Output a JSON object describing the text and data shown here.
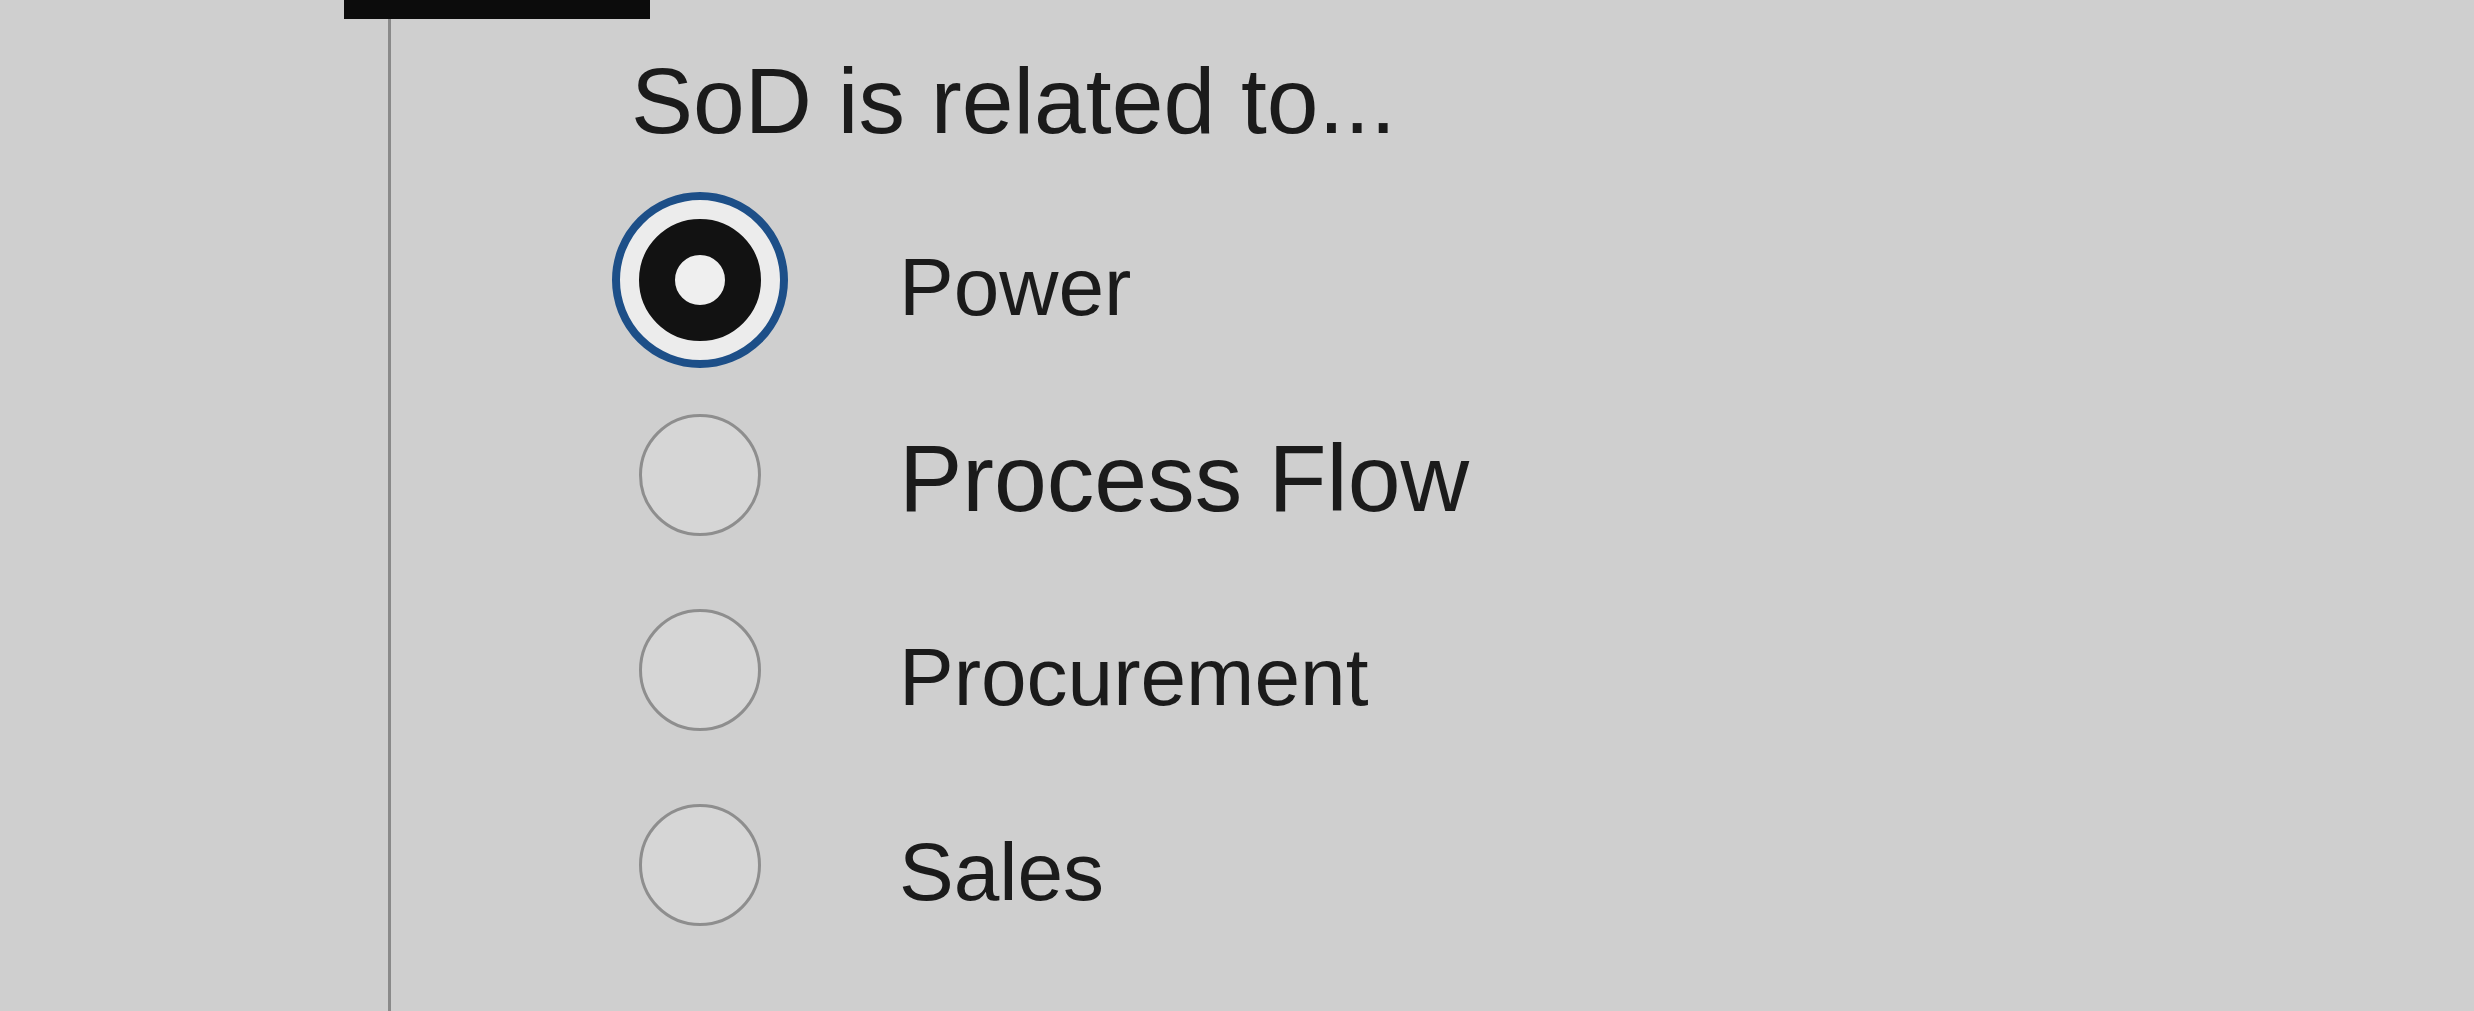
{
  "question": "SoD is related to...",
  "options": [
    {
      "label": "Power",
      "selected": true
    },
    {
      "label": "Process Flow",
      "selected": false
    },
    {
      "label": "Procurement",
      "selected": false
    },
    {
      "label": "Sales",
      "selected": false
    }
  ]
}
